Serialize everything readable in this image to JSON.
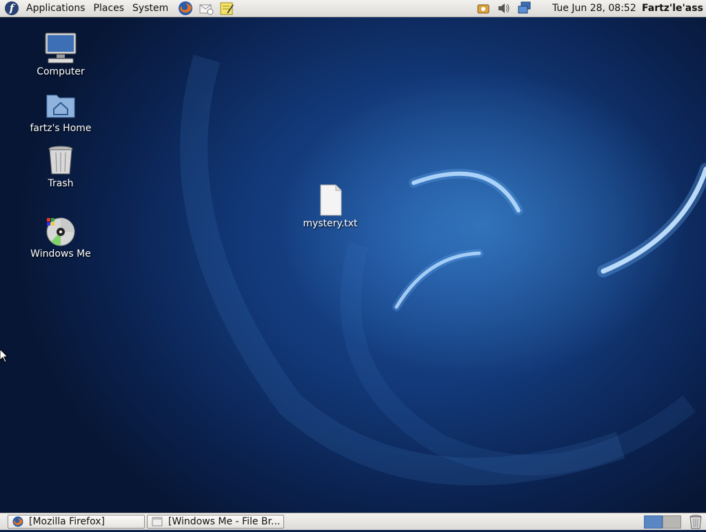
{
  "top_panel": {
    "menus": [
      "Applications",
      "Places",
      "System"
    ],
    "clock": "Tue Jun 28, 08:52",
    "user": "Fartz'le'ass",
    "launchers": [
      "firefox-icon",
      "evolution-mail-icon",
      "text-editor-icon"
    ],
    "tray": [
      "update-notifier-icon",
      "volume-icon",
      "network-icon"
    ]
  },
  "desktop": {
    "icons": [
      {
        "label": "Computer",
        "icon": "computer-icon"
      },
      {
        "label": "fartz's Home",
        "icon": "home-folder-icon"
      },
      {
        "label": "Trash",
        "icon": "trash-icon"
      },
      {
        "label": "Windows Me",
        "icon": "cd-disc-icon"
      },
      {
        "label": "mystery.txt",
        "icon": "text-file-icon"
      }
    ]
  },
  "bottom_panel": {
    "tasks": [
      {
        "label": "[Mozilla Firefox]",
        "icon": "firefox-icon"
      },
      {
        "label": "[Windows Me - File Br...",
        "icon": "file-browser-icon"
      }
    ],
    "workspaces": 2
  },
  "colors": {
    "panel_bg": "#e7e5e2",
    "wallpaper_base": "#123877",
    "workspace_active": "#5a86c4"
  }
}
